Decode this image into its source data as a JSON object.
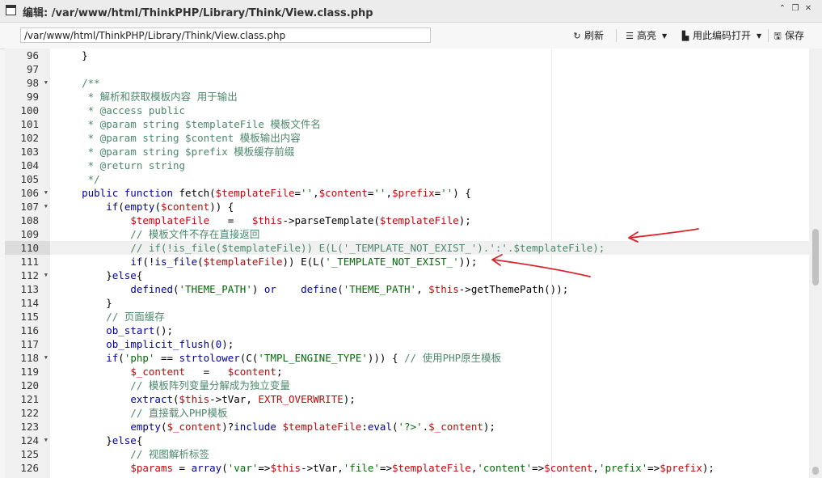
{
  "window": {
    "title": "编辑: /var/www/html/ThinkPHP/Library/Think/View.class.php",
    "controls": [
      "⌃",
      "❐",
      "✕"
    ]
  },
  "toolbar": {
    "path": "/var/www/html/ThinkPHP/Library/Think/View.class.php",
    "refresh_label": "刷新",
    "highlight_label": "高亮",
    "open_with_encoding_label": "用此编码打开",
    "save_label": "保存"
  },
  "editor": {
    "active_line": 110,
    "lines": [
      {
        "n": 96,
        "fold": false,
        "code": [
          [
            "p",
            "    }"
          ]
        ]
      },
      {
        "n": 97,
        "fold": false,
        "code": []
      },
      {
        "n": 98,
        "fold": true,
        "code": [
          [
            "c",
            "    /**"
          ]
        ]
      },
      {
        "n": 99,
        "fold": false,
        "code": [
          [
            "c",
            "     * 解析和获取模板内容 用于输出"
          ]
        ]
      },
      {
        "n": 100,
        "fold": false,
        "code": [
          [
            "c",
            "     * @access public"
          ]
        ]
      },
      {
        "n": 101,
        "fold": false,
        "code": [
          [
            "c",
            "     * @param string $templateFile 模板文件名"
          ]
        ]
      },
      {
        "n": 102,
        "fold": false,
        "code": [
          [
            "c",
            "     * @param string $content 模板输出内容"
          ]
        ]
      },
      {
        "n": 103,
        "fold": false,
        "code": [
          [
            "c",
            "     * @param string $prefix 模板缓存前缀"
          ]
        ]
      },
      {
        "n": 104,
        "fold": false,
        "code": [
          [
            "c",
            "     * @return string"
          ]
        ]
      },
      {
        "n": 105,
        "fold": false,
        "code": [
          [
            "c",
            "     */"
          ]
        ]
      },
      {
        "n": 106,
        "fold": true,
        "code": [
          [
            "k",
            "    public function "
          ],
          [
            "p",
            "fetch("
          ],
          [
            "v",
            "$templateFile"
          ],
          [
            "p",
            "="
          ],
          [
            "s",
            "''"
          ],
          [
            "p",
            ","
          ],
          [
            "v",
            "$content"
          ],
          [
            "p",
            "="
          ],
          [
            "s",
            "''"
          ],
          [
            "p",
            ","
          ],
          [
            "v",
            "$prefix"
          ],
          [
            "p",
            "="
          ],
          [
            "s",
            "''"
          ],
          [
            "p",
            ") {"
          ]
        ]
      },
      {
        "n": 107,
        "fold": true,
        "code": [
          [
            "p",
            "        "
          ],
          [
            "f",
            "if"
          ],
          [
            "p",
            "("
          ],
          [
            "f",
            "empty"
          ],
          [
            "p",
            "("
          ],
          [
            "v",
            "$content"
          ],
          [
            "p",
            ")) {"
          ]
        ]
      },
      {
        "n": 108,
        "fold": false,
        "code": [
          [
            "p",
            "            "
          ],
          [
            "v",
            "$templateFile"
          ],
          [
            "p",
            "   =   "
          ],
          [
            "v",
            "$this"
          ],
          [
            "p",
            "->parseTemplate("
          ],
          [
            "v",
            "$templateFile"
          ],
          [
            "p",
            ");"
          ]
        ]
      },
      {
        "n": 109,
        "fold": false,
        "code": [
          [
            "c",
            "            // 模板文件不存在直接返回"
          ]
        ]
      },
      {
        "n": 110,
        "fold": false,
        "code": [
          [
            "c",
            "            // if(!is_file($templateFile)) E(L('_TEMPLATE_NOT_EXIST_').':'.$templateFile);"
          ]
        ]
      },
      {
        "n": 111,
        "fold": false,
        "code": [
          [
            "p",
            "            "
          ],
          [
            "f",
            "if"
          ],
          [
            "p",
            "(!"
          ],
          [
            "f",
            "is_file"
          ],
          [
            "p",
            "("
          ],
          [
            "v",
            "$templateFile"
          ],
          [
            "p",
            ")) E(L("
          ],
          [
            "s",
            "'_TEMPLATE_NOT_EXIST_'"
          ],
          [
            "p",
            "));"
          ]
        ]
      },
      {
        "n": 112,
        "fold": true,
        "code": [
          [
            "p",
            "        }"
          ],
          [
            "f",
            "else"
          ],
          [
            "p",
            "{"
          ]
        ]
      },
      {
        "n": 113,
        "fold": false,
        "code": [
          [
            "p",
            "            "
          ],
          [
            "f",
            "defined"
          ],
          [
            "p",
            "("
          ],
          [
            "s",
            "'THEME_PATH'"
          ],
          [
            "p",
            ") "
          ],
          [
            "f",
            "or"
          ],
          [
            "p",
            "    "
          ],
          [
            "f",
            "define"
          ],
          [
            "p",
            "("
          ],
          [
            "s",
            "'THEME_PATH'"
          ],
          [
            "p",
            ", "
          ],
          [
            "v",
            "$this"
          ],
          [
            "p",
            "->getThemePath());"
          ]
        ]
      },
      {
        "n": 114,
        "fold": false,
        "code": [
          [
            "p",
            "        }"
          ]
        ]
      },
      {
        "n": 115,
        "fold": false,
        "code": [
          [
            "c",
            "        // 页面缓存"
          ]
        ]
      },
      {
        "n": 116,
        "fold": false,
        "code": [
          [
            "p",
            "        "
          ],
          [
            "f",
            "ob_start"
          ],
          [
            "p",
            "();"
          ]
        ]
      },
      {
        "n": 117,
        "fold": false,
        "code": [
          [
            "p",
            "        "
          ],
          [
            "f",
            "ob_implicit_flush"
          ],
          [
            "p",
            "("
          ],
          [
            "n",
            "0"
          ],
          [
            "p",
            ");"
          ]
        ]
      },
      {
        "n": 118,
        "fold": true,
        "code": [
          [
            "p",
            "        "
          ],
          [
            "f",
            "if"
          ],
          [
            "p",
            "("
          ],
          [
            "s",
            "'php'"
          ],
          [
            "p",
            " == "
          ],
          [
            "f",
            "strtolower"
          ],
          [
            "p",
            "(C("
          ],
          [
            "s",
            "'TMPL_ENGINE_TYPE'"
          ],
          [
            "p",
            "))) { "
          ],
          [
            "c",
            "// 使用PHP原生模板"
          ]
        ]
      },
      {
        "n": 119,
        "fold": false,
        "code": [
          [
            "p",
            "            "
          ],
          [
            "v",
            "$_content"
          ],
          [
            "p",
            "   =   "
          ],
          [
            "v",
            "$content"
          ],
          [
            "p",
            ";"
          ]
        ]
      },
      {
        "n": 120,
        "fold": false,
        "code": [
          [
            "c",
            "            // 模板阵列变量分解成为独立变量"
          ]
        ]
      },
      {
        "n": 121,
        "fold": false,
        "code": [
          [
            "p",
            "            "
          ],
          [
            "f",
            "extract"
          ],
          [
            "p",
            "("
          ],
          [
            "v",
            "$this"
          ],
          [
            "p",
            "->tVar, "
          ],
          [
            "v",
            "EXTR_OVERWRITE"
          ],
          [
            "p",
            ");"
          ]
        ]
      },
      {
        "n": 122,
        "fold": false,
        "code": [
          [
            "c",
            "            // 直接载入PHP模板"
          ]
        ]
      },
      {
        "n": 123,
        "fold": false,
        "code": [
          [
            "p",
            "            "
          ],
          [
            "f",
            "empty"
          ],
          [
            "p",
            "("
          ],
          [
            "v",
            "$_content"
          ],
          [
            "p",
            ")?"
          ],
          [
            "k",
            "include "
          ],
          [
            "v",
            "$templateFile"
          ],
          [
            "p",
            ":"
          ],
          [
            "k",
            "eval"
          ],
          [
            "p",
            "("
          ],
          [
            "s",
            "'?>'"
          ],
          [
            "p",
            "."
          ],
          [
            "v",
            "$_content"
          ],
          [
            "p",
            ");"
          ]
        ]
      },
      {
        "n": 124,
        "fold": true,
        "code": [
          [
            "p",
            "        }"
          ],
          [
            "f",
            "else"
          ],
          [
            "p",
            "{"
          ]
        ]
      },
      {
        "n": 125,
        "fold": false,
        "code": [
          [
            "c",
            "            // 视图解析标签"
          ]
        ]
      },
      {
        "n": 126,
        "fold": false,
        "code": [
          [
            "p",
            "            "
          ],
          [
            "v",
            "$params"
          ],
          [
            "p",
            " = "
          ],
          [
            "f",
            "array"
          ],
          [
            "p",
            "("
          ],
          [
            "s",
            "'var'"
          ],
          [
            "p",
            "=>"
          ],
          [
            "v",
            "$this"
          ],
          [
            "p",
            "->tVar,"
          ],
          [
            "s",
            "'file'"
          ],
          [
            "p",
            "=>"
          ],
          [
            "v",
            "$templateFile"
          ],
          [
            "p",
            ","
          ],
          [
            "s",
            "'content'"
          ],
          [
            "p",
            "=>"
          ],
          [
            "v",
            "$content"
          ],
          [
            "p",
            ","
          ],
          [
            "s",
            "'prefix'"
          ],
          [
            "p",
            "=>"
          ],
          [
            "v",
            "$prefix"
          ],
          [
            "p",
            ");"
          ]
        ]
      }
    ]
  },
  "colors": {
    "annotation_arrow": "#d9252b"
  }
}
